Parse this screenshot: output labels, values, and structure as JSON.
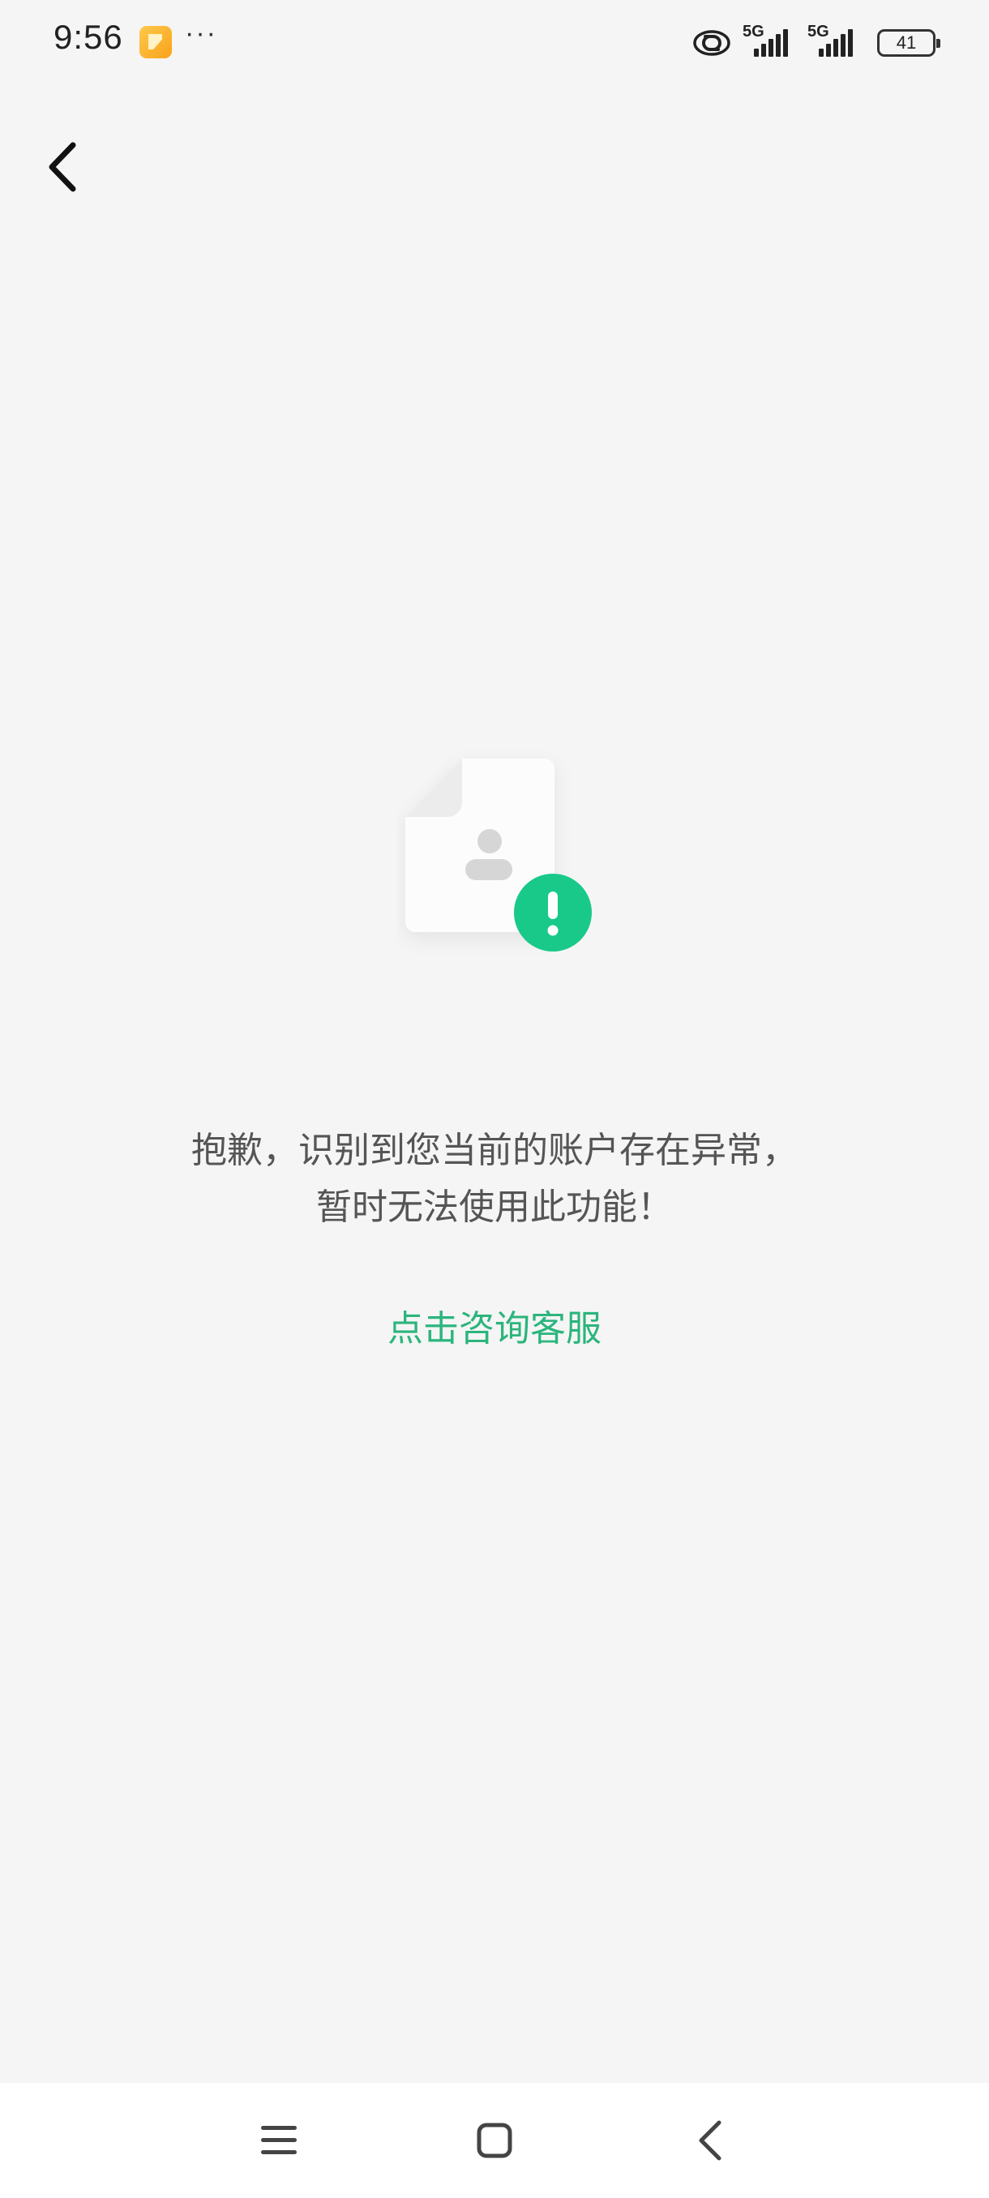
{
  "status_bar": {
    "time": "9:56",
    "more": "···",
    "network_1": "5G",
    "network_2": "5G",
    "battery": "41"
  },
  "colors": {
    "background": "#f5f5f5",
    "accent_green": "#2bb57c",
    "badge_green": "#19c98a",
    "text_gray": "#555555"
  },
  "icons": {
    "back": "back-arrow-icon",
    "illustration": "account-document-warning-icon",
    "nav_menu": "menu-icon",
    "nav_home": "home-icon",
    "nav_back": "back-icon"
  },
  "message": {
    "line1": "抱歉，识别到您当前的账户存在异常，",
    "line2": "暂时无法使用此功能！"
  },
  "contact_link": "点击咨询客服"
}
